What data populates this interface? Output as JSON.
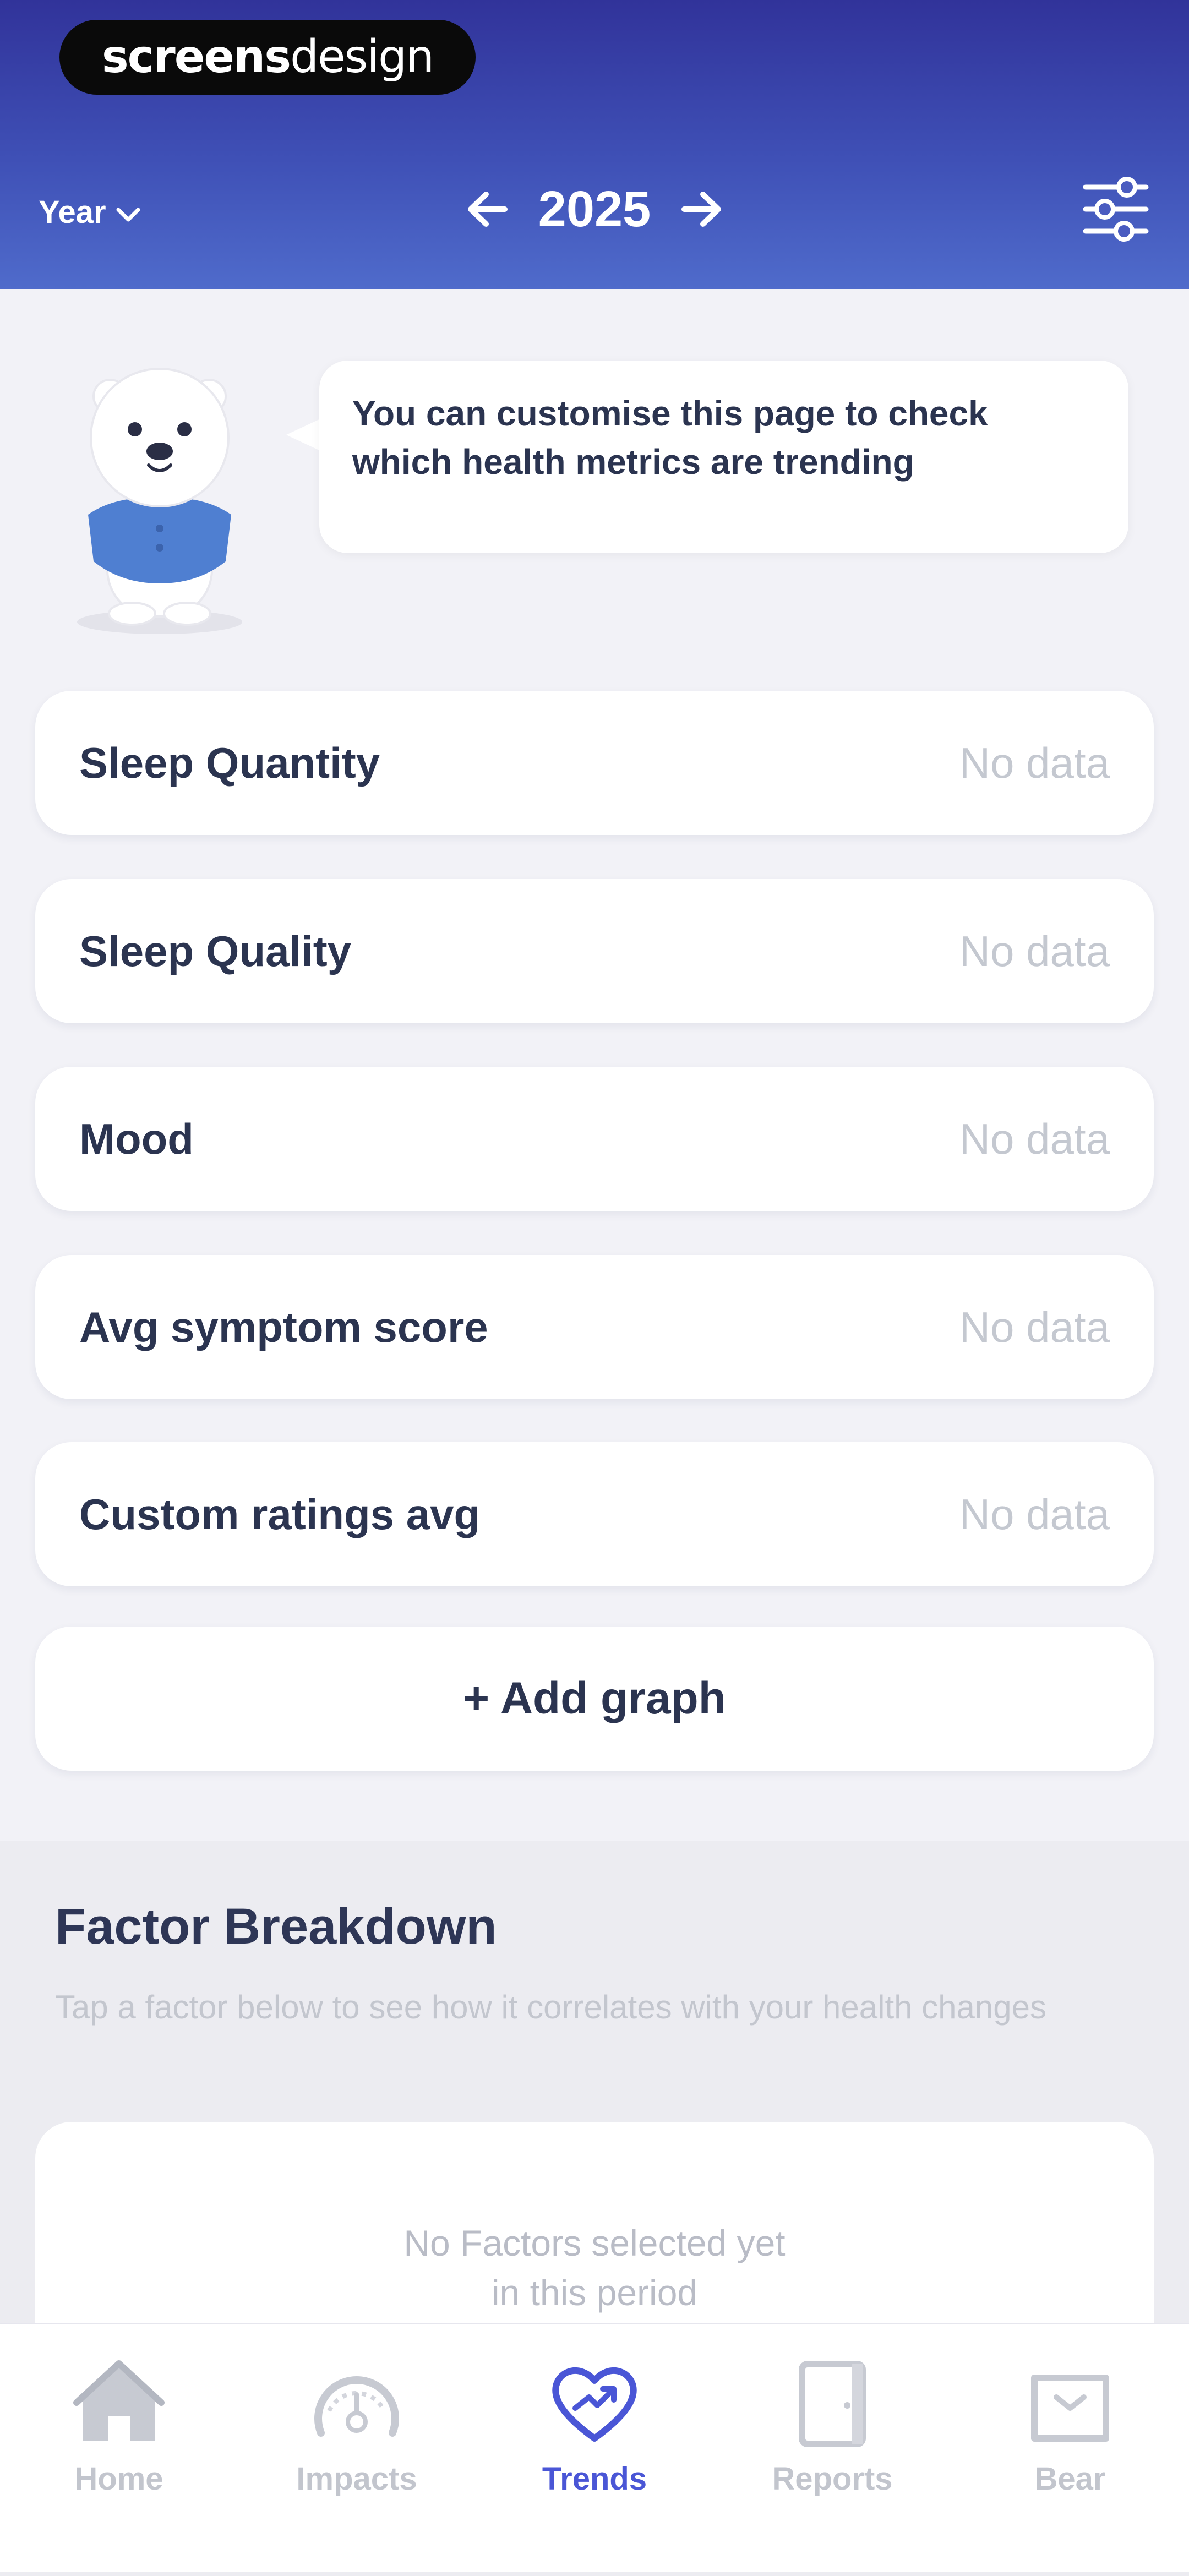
{
  "brand": {
    "bold": "screens",
    "light": "design"
  },
  "header": {
    "period": "Year",
    "year": "2025"
  },
  "mascot_message": "You can customise this page to check which health metrics are trending",
  "metrics": [
    {
      "label": "Sleep Quantity",
      "value": "No data"
    },
    {
      "label": "Sleep Quality",
      "value": "No data"
    },
    {
      "label": "Mood",
      "value": "No data"
    },
    {
      "label": "Avg symptom score",
      "value": "No data"
    },
    {
      "label": "Custom ratings avg",
      "value": "No data"
    }
  ],
  "add_graph_label": "+ Add graph",
  "factor": {
    "title": "Factor Breakdown",
    "description": "Tap a factor below to see how it correlates with your health changes",
    "empty_line1": "No Factors selected yet",
    "empty_line2": "in this period"
  },
  "nav": [
    {
      "label": "Home",
      "icon": "home-icon",
      "active": false
    },
    {
      "label": "Impacts",
      "icon": "gauge-icon",
      "active": false
    },
    {
      "label": "Trends",
      "icon": "heart-trend-icon",
      "active": true
    },
    {
      "label": "Reports",
      "icon": "report-icon",
      "active": false
    },
    {
      "label": "Bear",
      "icon": "bear-icon",
      "active": false
    }
  ],
  "colors": {
    "header_start": "#31339a",
    "header_end": "#4f6bcb",
    "accent": "#4a56d6",
    "background": "#f2f2f7"
  }
}
